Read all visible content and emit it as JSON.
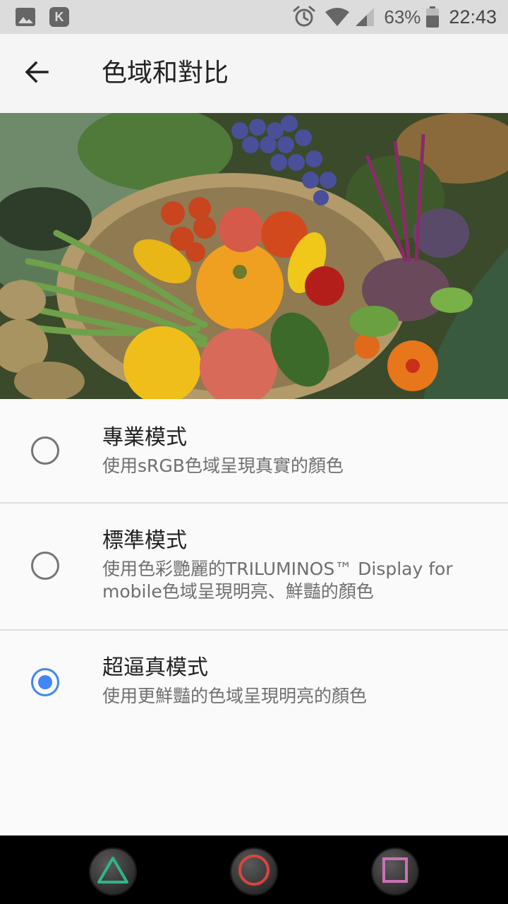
{
  "status_bar": {
    "left_icons": [
      "image-icon",
      "k-app-icon"
    ],
    "k_icon_letter": "K",
    "right_icons": [
      "alarm-icon",
      "wifi-icon",
      "signal-icon",
      "battery-icon"
    ],
    "battery_percent": "63%",
    "time": "22:43"
  },
  "app_bar": {
    "back_icon": "arrow-left-icon",
    "title": "色域和對比"
  },
  "options": [
    {
      "title": "專業模式",
      "subtitle": "使用sRGB色域呈現真實的顏色",
      "selected": false
    },
    {
      "title": "標準模式",
      "subtitle_line1": "使用色彩艷麗的TRILUMINOS™ Display for",
      "subtitle_line2": "mobile色域呈現明亮、鮮豔的顏色",
      "selected": false
    },
    {
      "title": "超逼真模式",
      "subtitle": "使用更鮮豔的色域呈現明亮的顏色",
      "selected": true
    }
  ],
  "nav_bar": {
    "buttons": [
      "triangle-icon",
      "circle-icon",
      "square-icon"
    ]
  },
  "colors": {
    "accent": "#4285f4",
    "triangle": "#2fb58c",
    "circle": "#d9453f",
    "square": "#c972b5"
  }
}
